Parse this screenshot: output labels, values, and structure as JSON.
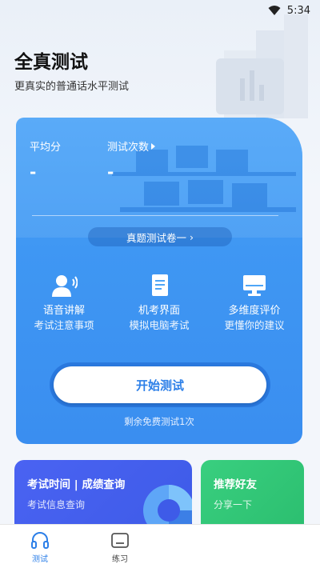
{
  "status_bar": {
    "time": "5:34"
  },
  "header": {
    "title": "全真测试",
    "subtitle": "更真实的普通话水平测试"
  },
  "stats": {
    "avg_label": "平均分",
    "avg_value": "-",
    "count_label": "测试次数",
    "count_value": "-"
  },
  "paper_selector": {
    "label": "真题测试卷一",
    "chevron": "›"
  },
  "features": [
    {
      "icon": "voice-user-icon",
      "name": "语音讲解",
      "desc": "考试注意事项"
    },
    {
      "icon": "document-icon",
      "name": "机考界面",
      "desc": "模拟电脑考试"
    },
    {
      "icon": "monitor-icon",
      "name": "多维度评价",
      "desc": "更懂你的建议"
    }
  ],
  "start_button": {
    "label": "开始测试"
  },
  "remaining": "剩余免费测试1次",
  "cards": [
    {
      "title": "考试时间 | 成绩查询",
      "subtitle": "考试信息查询"
    },
    {
      "title": "推荐好友",
      "subtitle": "分享一下"
    }
  ],
  "tabbar": [
    {
      "label": "测试",
      "icon": "headphones-icon",
      "active": true
    },
    {
      "label": "练习",
      "icon": "folder-icon",
      "active": false
    }
  ],
  "colors": {
    "accent": "#2c7fe8",
    "card_blue": "#3f97f3",
    "card_indigo": "#4a63f2",
    "card_green": "#39cf7f"
  }
}
